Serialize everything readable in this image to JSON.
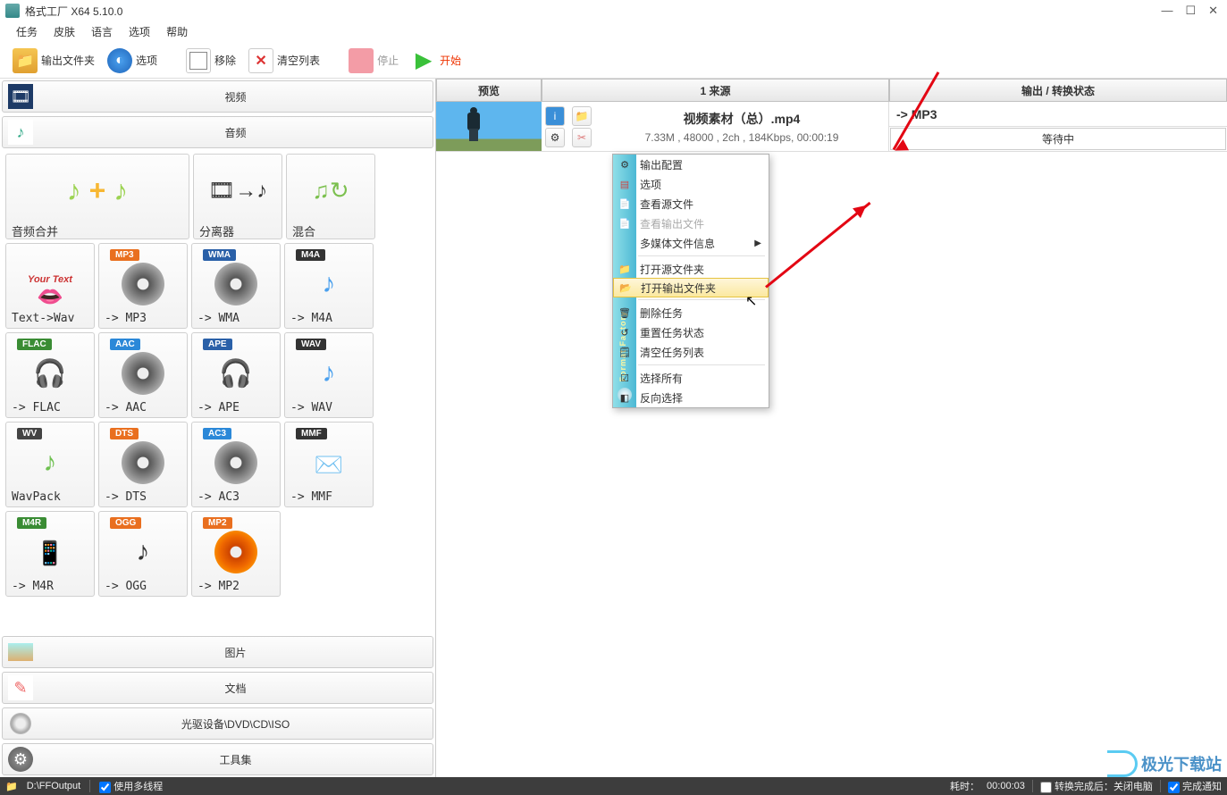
{
  "title": "格式工厂 X64 5.10.0",
  "menu": [
    "任务",
    "皮肤",
    "语言",
    "选项",
    "帮助"
  ],
  "toolbar": {
    "output_folder": "输出文件夹",
    "options": "选项",
    "remove": "移除",
    "clear": "清空列表",
    "stop": "停止",
    "start": "开始"
  },
  "categories": {
    "video": "视频",
    "audio": "音频",
    "picture": "图片",
    "document": "文档",
    "cd": "光驱设备\\DVD\\CD\\ISO",
    "tools": "工具集"
  },
  "tiles": {
    "merge": "音频合并",
    "split": "分离器",
    "mix": "混合",
    "text_wav": "Text->Wav",
    "mp3": "-> MP3",
    "wma": "-> WMA",
    "m4a": "-> M4A",
    "flac": "-> FLAC",
    "aac": "-> AAC",
    "ape": "-> APE",
    "wav": "-> WAV",
    "wavpack": "WavPack",
    "dts": "-> DTS",
    "ac3": "-> AC3",
    "mmf": "-> MMF",
    "m4r": "-> M4R",
    "ogg": "-> OGG",
    "mp2": "-> MP2"
  },
  "badges": {
    "mp3": "MP3",
    "wma": "WMA",
    "m4a": "M4A",
    "flac": "FLAC",
    "aac": "AAC",
    "ape": "APE",
    "wav": "WAV",
    "wv": "WV",
    "dts": "DTS",
    "ac3": "AC3",
    "mmf": "MMF",
    "m4r": "M4R",
    "ogg": "OGG",
    "mp2": "MP2"
  },
  "headers": {
    "preview": "预览",
    "source": "1 来源",
    "output": "输出 / 转换状态"
  },
  "task": {
    "name": "视频素材（总）.mp4",
    "meta": "7.33M , 48000 , 2ch , 184Kbps, 00:00:19",
    "out": "->  MP3",
    "status": "等待中"
  },
  "context": {
    "output_cfg": "输出配置",
    "options": "选项",
    "view_src": "查看源文件",
    "view_out": "查看输出文件",
    "media_info": "多媒体文件信息",
    "open_src_folder": "打开源文件夹",
    "open_out_folder": "打开输出文件夹",
    "delete_task": "删除任务",
    "reset_status": "重置任务状态",
    "clear_list": "清空任务列表",
    "select_all": "选择所有",
    "invert": "反向选择",
    "sidetext": "Format Factory"
  },
  "status": {
    "path": "D:\\FFOutput",
    "threads": "使用多线程",
    "elapsed_label": "耗时：",
    "elapsed": "00:00:03",
    "after_label": "转换完成后：",
    "after_val": "关闭电脑",
    "notify": "完成通知"
  },
  "watermark": "极光下载站"
}
